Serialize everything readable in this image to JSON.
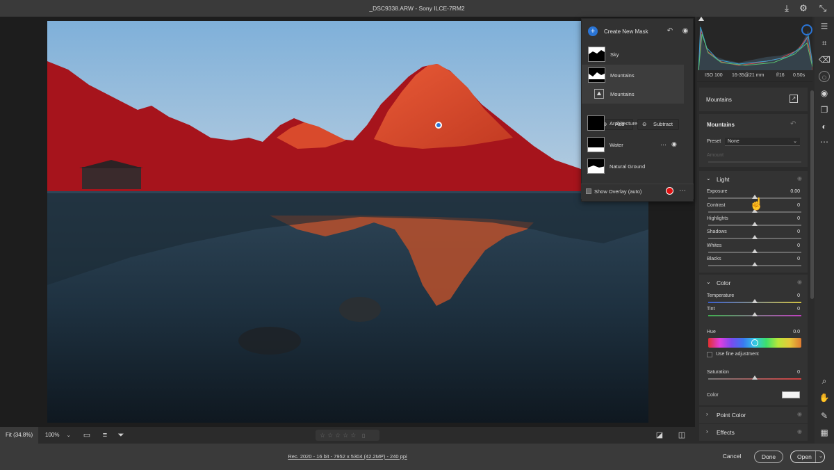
{
  "window": {
    "title": "_DSC9338.ARW  -  Sony ILCE-7RM2"
  },
  "titlebar_icons": [
    "download-icon",
    "gear-icon",
    "collapse-icon"
  ],
  "mask_panel": {
    "create_label": "Create New Mask",
    "masks": [
      {
        "label": "Sky"
      },
      {
        "label": "Mountains"
      },
      {
        "label": "Architecture"
      },
      {
        "label": "Water"
      },
      {
        "label": "Natural Ground"
      }
    ],
    "sub_component": {
      "label": "Mountains"
    },
    "add_label": "Add",
    "subtract_label": "Subtract",
    "show_overlay_label": "Show Overlay (auto)",
    "overlay_color": "#e01010"
  },
  "histogram": {
    "iso": "ISO 100",
    "lens": "16-35@21 mm",
    "aperture": "f/16",
    "shutter": "0.50s"
  },
  "panel": {
    "header": "Mountains",
    "mask_name": "Mountains",
    "preset_label": "Preset",
    "preset_value": "None",
    "amount_label": "Amount",
    "light": {
      "title": "Light",
      "sliders": [
        {
          "label": "Exposure",
          "value": "0.00"
        },
        {
          "label": "Contrast",
          "value": "0"
        },
        {
          "label": "Highlights",
          "value": "0"
        },
        {
          "label": "Shadows",
          "value": "0"
        },
        {
          "label": "Whites",
          "value": "0"
        },
        {
          "label": "Blacks",
          "value": "0"
        }
      ]
    },
    "color": {
      "title": "Color",
      "temperature_label": "Temperature",
      "temperature_value": "0",
      "tint_label": "Tint",
      "tint_value": "0",
      "hue_label": "Hue",
      "hue_value": "0.0",
      "fine_label": "Use fine adjustment",
      "saturation_label": "Saturation",
      "saturation_value": "0",
      "color_label": "Color"
    },
    "point_color": {
      "title": "Point Color"
    },
    "effects": {
      "title": "Effects"
    }
  },
  "bottom": {
    "fit": "Fit (34.8%)",
    "zoom": "100%",
    "stars": "☆☆☆☆☆"
  },
  "footer": {
    "info": "Rec. 2020 - 16 bit - 7952 x 5304 (42.2MP) - 240 ppi",
    "cancel": "Cancel",
    "done": "Done",
    "open": "Open"
  }
}
